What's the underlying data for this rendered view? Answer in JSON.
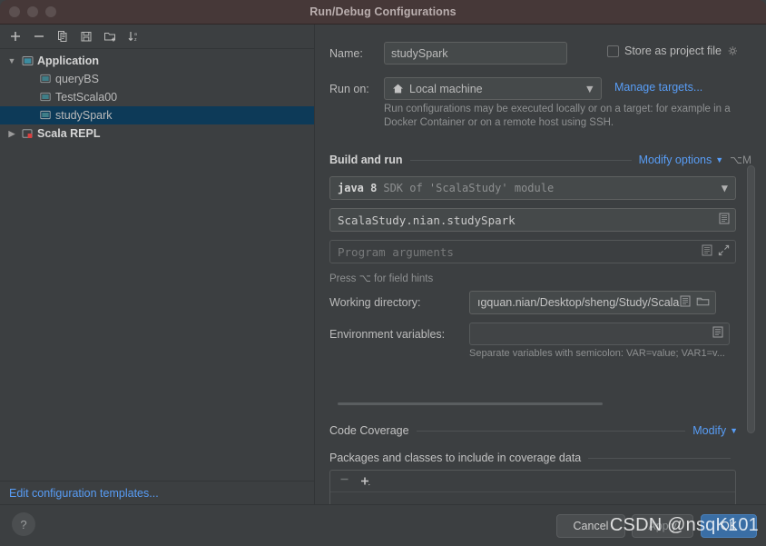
{
  "window": {
    "title": "Run/Debug Configurations",
    "traffic_lights": [
      "close",
      "minimize",
      "zoom"
    ]
  },
  "sidebar": {
    "toolbar": [
      {
        "name": "add-configuration-button",
        "icon": "plus-icon"
      },
      {
        "name": "remove-configuration-button",
        "icon": "minus-icon"
      },
      {
        "name": "copy-configuration-button",
        "icon": "copy-icon"
      },
      {
        "name": "save-configuration-button",
        "icon": "save-icon"
      },
      {
        "name": "move-to-folder-button",
        "icon": "folder-add-icon"
      },
      {
        "name": "sort-configurations-button",
        "icon": "sort-az-icon"
      }
    ],
    "tree": [
      {
        "label": "Application",
        "type": "group",
        "expanded": true,
        "icon": "application-icon"
      },
      {
        "label": "queryBS",
        "type": "item",
        "selected": false,
        "icon": "config-icon"
      },
      {
        "label": "TestScala00",
        "type": "item",
        "selected": false,
        "icon": "config-icon"
      },
      {
        "label": "studySpark",
        "type": "item",
        "selected": true,
        "icon": "config-icon"
      },
      {
        "label": "Scala REPL",
        "type": "group",
        "expanded": false,
        "icon": "scala-repl-icon"
      }
    ],
    "edit_templates_link": "Edit configuration templates..."
  },
  "form": {
    "name_label": "Name:",
    "name_value": "studySpark",
    "store_as_project_file_label": "Store as project file",
    "store_as_project_file_checked": false,
    "run_on_label": "Run on:",
    "run_on_value": "Local machine",
    "manage_targets_link": "Manage targets...",
    "run_on_hint": "Run configurations may be executed locally or on a target: for example in a Docker Container or on a remote host using SSH.",
    "build_and_run": {
      "section_title": "Build and run",
      "modify_options_label": "Modify options",
      "modify_options_shortcut": "⌥M",
      "sdk_main": "java 8",
      "sdk_sub": "SDK of 'ScalaStudy' module",
      "main_class_value": "ScalaStudy.nian.studySpark",
      "program_arguments_placeholder": "Program arguments",
      "field_hints_note": "Press ⌥ for field hints"
    },
    "working_directory_label": "Working directory:",
    "working_directory_value": "ıgquan.nian/Desktop/sheng/Study/Scala",
    "environment_variables_label": "Environment variables:",
    "environment_variables_value": "",
    "environment_variables_note": "Separate variables with semicolon: VAR=value; VAR1=v...",
    "code_coverage": {
      "section_title": "Code Coverage",
      "modify_label": "Modify",
      "packages_label": "Packages and classes to include in coverage data"
    }
  },
  "footer": {
    "help_label": "?",
    "cancel_label": "Cancel",
    "apply_label": "Apply",
    "ok_label": "OK"
  },
  "watermark": {
    "text": "CSDN @nsqK101"
  },
  "colors": {
    "background": "#3c3f41",
    "titlebar": "#463838",
    "link": "#589df6",
    "selection": "#0d3a58",
    "ok_button": "#3a6ea5",
    "field_background": "#45494a",
    "text": "#bbbbbb"
  }
}
